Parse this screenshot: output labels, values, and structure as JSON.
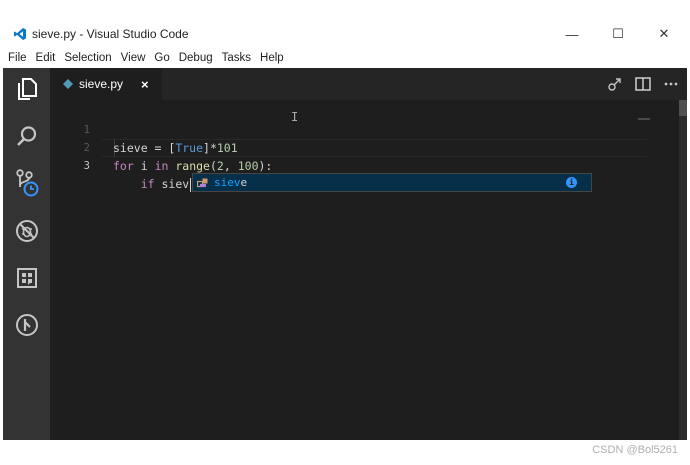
{
  "window": {
    "title": "sieve.py - Visual Studio Code",
    "controls": {
      "minimize": "—",
      "maximize": "☐",
      "close": "✕"
    }
  },
  "menubar": {
    "items": [
      "File",
      "Edit",
      "Selection",
      "View",
      "Go",
      "Debug",
      "Tasks",
      "Help"
    ]
  },
  "activitybar": {
    "icons": [
      "explorer-icon",
      "search-icon",
      "source-control-icon",
      "debug-icon",
      "extensions-icon",
      "remote-icon"
    ]
  },
  "tab": {
    "label": "sieve.py",
    "close": "×"
  },
  "editor": {
    "line_numbers": [
      "1",
      "2",
      "3"
    ],
    "lines": [
      {
        "tokens": [
          [
            "plain",
            "sieve = ["
          ],
          [
            "kw",
            "True"
          ],
          [
            "plain",
            "]*"
          ],
          [
            "num",
            "101"
          ]
        ]
      },
      {
        "tokens": [
          [
            "kwc",
            "for"
          ],
          [
            "plain",
            " i "
          ],
          [
            "kwc",
            "in"
          ],
          [
            "plain",
            " "
          ],
          [
            "bi",
            "range"
          ],
          [
            "plain",
            "("
          ],
          [
            "num",
            "2"
          ],
          [
            "plain",
            ", "
          ],
          [
            "num",
            "100"
          ],
          [
            "plain",
            "):"
          ]
        ]
      },
      {
        "tokens": [
          [
            "plain",
            "    "
          ],
          [
            "kwc",
            "if"
          ],
          [
            "plain",
            " siev"
          ]
        ]
      }
    ]
  },
  "suggest": {
    "match": "siev",
    "rest": "e",
    "info": "i"
  },
  "colors": {
    "accent": "#007acc",
    "editor_bg": "#1e1e1e",
    "activitybar_bg": "#333333"
  },
  "watermark": "CSDN @Bol5261"
}
